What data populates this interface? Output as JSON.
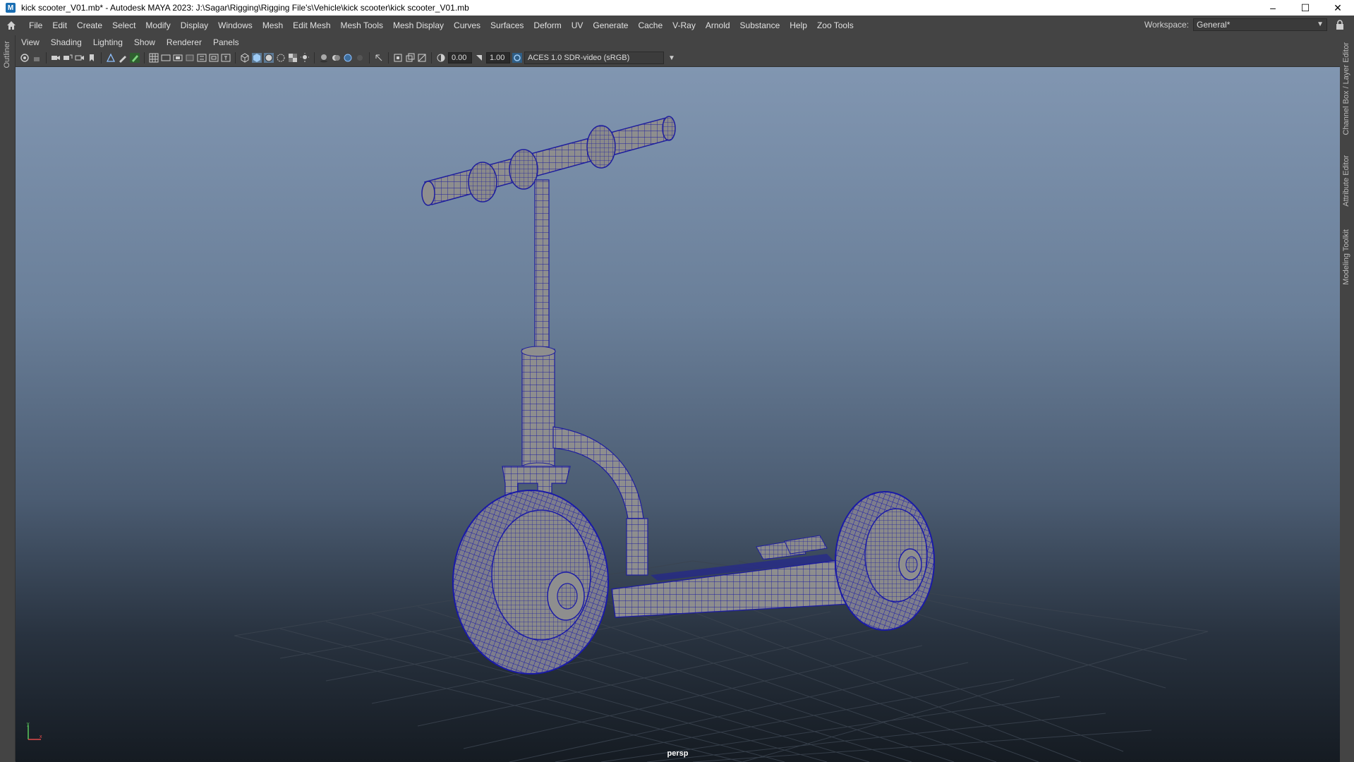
{
  "window": {
    "title": "kick scooter_V01.mb* - Autodesk MAYA 2023: J:\\Sagar\\Rigging\\Rigging File's\\Vehicle\\kick scooter\\kick scooter_V01.mb",
    "app_icon": "M",
    "controls": [
      "–",
      "☐",
      "✕"
    ]
  },
  "menubar": {
    "items": [
      "File",
      "Edit",
      "Create",
      "Select",
      "Modify",
      "Display",
      "Windows",
      "Mesh",
      "Edit Mesh",
      "Mesh Tools",
      "Mesh Display",
      "Curves",
      "Surfaces",
      "Deform",
      "UV",
      "Generate",
      "Cache",
      "V-Ray",
      "Arnold",
      "Substance",
      "Help",
      "Zoo Tools"
    ],
    "workspace_label": "Workspace:",
    "workspace_value": "General*"
  },
  "side_tabs": {
    "left": "Outliner",
    "right": [
      "Channel Box / Layer Editor",
      "Attribute Editor",
      "Modeling Toolkit"
    ]
  },
  "panel_menu": [
    "View",
    "Shading",
    "Lighting",
    "Show",
    "Renderer",
    "Panels"
  ],
  "panel_toolbar": {
    "exposure": "0.00",
    "gamma": "1.00",
    "color_space": "ACES 1.0 SDR-video (sRGB)"
  },
  "viewport": {
    "camera": "persp",
    "gizmo_axes": [
      "y",
      "x"
    ],
    "colors": {
      "wireframe": "#1e1ea0",
      "mesh": "#8d8d8d",
      "grid": "#3b4450"
    },
    "object": "kick scooter"
  }
}
